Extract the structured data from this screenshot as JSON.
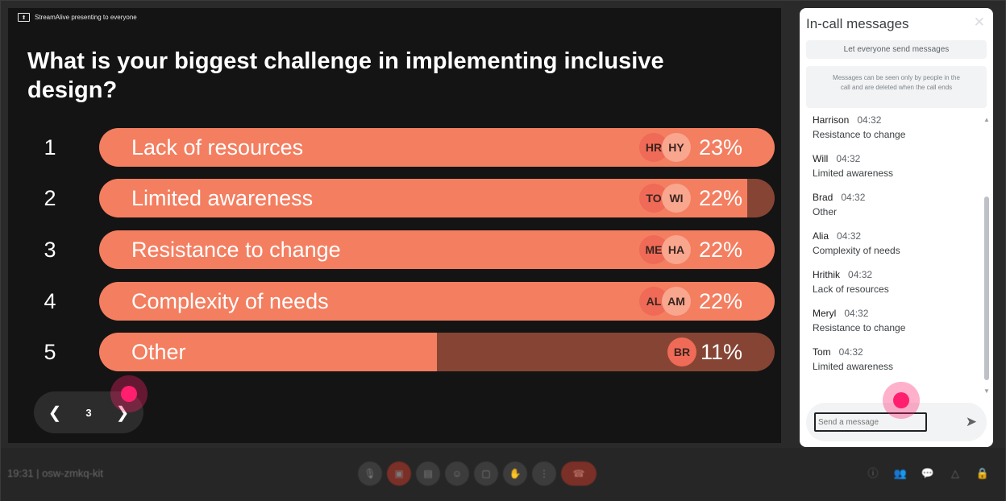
{
  "stage": {
    "presenting_text": "StreamAlive presenting to everyone",
    "question": "What is your biggest challenge in implementing inclusive design?",
    "options": [
      {
        "num": "1",
        "label": "Lack of resources",
        "percent": 23,
        "pct_text": "23%",
        "avatars": [
          "HR",
          "HY"
        ]
      },
      {
        "num": "2",
        "label": "Limited awareness",
        "percent": 22,
        "pct_text": "22%",
        "avatars": [
          "TO",
          "WI"
        ]
      },
      {
        "num": "3",
        "label": "Resistance to change",
        "percent": 22,
        "pct_text": "22%",
        "avatars": [
          "ME",
          "HA"
        ]
      },
      {
        "num": "4",
        "label": "Complexity of needs",
        "percent": 22,
        "pct_text": "22%",
        "avatars": [
          "AL",
          "AM"
        ]
      },
      {
        "num": "5",
        "label": "Other",
        "percent": 11,
        "pct_text": "11%",
        "avatars": [
          "BR"
        ]
      }
    ],
    "fill_ratio": [
      1.0,
      0.96,
      1.0,
      1.0,
      0.5
    ],
    "pager": {
      "page": "3",
      "prev_icon": "chevron-left-icon",
      "next_icon": "chevron-right-icon"
    },
    "colors": {
      "bar_fill": "#f47e60",
      "bar_track": "#864534",
      "avatar_dark": "#ef6a57",
      "avatar_light": "#f9a68f",
      "cursor": "#ff1f6e"
    }
  },
  "chat": {
    "title": "In-call messages",
    "close_icon": "close-icon",
    "toggle_label": "Let everyone send messages",
    "notice": "Messages can be seen only by people in the call and are deleted when the call ends",
    "messages": [
      {
        "name": "Harrison",
        "time": "04:32",
        "text": "Resistance to change"
      },
      {
        "name": "Will",
        "time": "04:32",
        "text": "Limited awareness"
      },
      {
        "name": "Brad",
        "time": "04:32",
        "text": "Other"
      },
      {
        "name": "Alia",
        "time": "04:32",
        "text": "Complexity of needs"
      },
      {
        "name": "Hrithik",
        "time": "04:32",
        "text": "Lack of resources"
      },
      {
        "name": "Meryl",
        "time": "04:32",
        "text": "Resistance to change"
      },
      {
        "name": "Tom",
        "time": "04:32",
        "text": "Limited awareness"
      }
    ],
    "input_placeholder": "Send a message",
    "send_icon": "send-icon"
  },
  "bottombar": {
    "meeting_info": "19:31 | osw-zmkq-kit",
    "controls": [
      "mic-icon",
      "camera-off-icon",
      "captions-icon",
      "emoji-icon",
      "present-icon",
      "raise-hand-icon",
      "more-icon",
      "hang-up-icon"
    ],
    "right_controls": [
      "info-icon",
      "people-icon",
      "chat-icon",
      "activities-icon",
      "host-controls-icon"
    ]
  }
}
